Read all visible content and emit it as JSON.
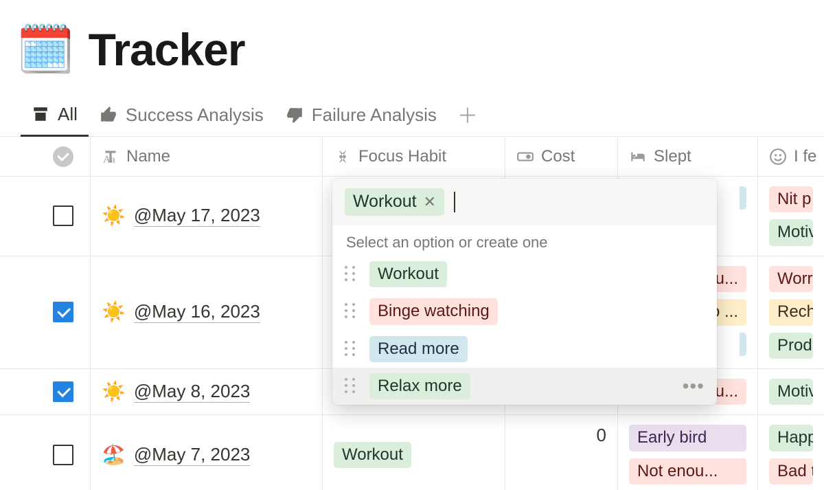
{
  "page": {
    "emoji": "🗓️",
    "title": "Tracker"
  },
  "tabs": [
    {
      "label": "All",
      "icon": "archive",
      "active": true
    },
    {
      "label": "Success Analysis",
      "icon": "thumbs-up",
      "active": false
    },
    {
      "label": "Failure Analysis",
      "icon": "thumbs-down",
      "active": false
    }
  ],
  "columns": {
    "name": "Name",
    "focus": "Focus Habit",
    "cost": "Cost",
    "slept": "Slept",
    "feel": "I fe"
  },
  "rows": [
    {
      "checked": false,
      "emoji": "☀️",
      "name": "@May 17, 2023",
      "slept_sliver": "blue",
      "feel": [
        {
          "text": "Nit p",
          "color": "red"
        },
        {
          "text": "Motiv",
          "color": "green"
        }
      ]
    },
    {
      "checked": true,
      "emoji": "☀️",
      "name": "@May 16, 2023",
      "peek": [
        {
          "text": "u...",
          "color": "red"
        },
        {
          "text": "o ...",
          "color": "yellow"
        },
        {
          "sliver": true,
          "color": "blue"
        }
      ],
      "feel": [
        {
          "text": "Worr",
          "color": "red"
        },
        {
          "text": "Rech",
          "color": "yellow"
        },
        {
          "text": "Prod",
          "color": "green"
        }
      ]
    },
    {
      "checked": true,
      "emoji": "☀️",
      "name": "@May 8, 2023",
      "peek": [
        {
          "text": "u...",
          "color": "red"
        }
      ],
      "feel": [
        {
          "text": "Motiv",
          "color": "green"
        }
      ]
    },
    {
      "checked": false,
      "emoji": "🏖️",
      "name": "@May 7, 2023",
      "focus": {
        "text": "Workout",
        "color": "green"
      },
      "cost": "0",
      "slept": [
        {
          "text": "Early bird",
          "color": "purple"
        },
        {
          "text": "Not enou...",
          "color": "red"
        }
      ],
      "feel": [
        {
          "text": "Happ",
          "color": "green"
        },
        {
          "text": "Bad t",
          "color": "red"
        }
      ]
    }
  ],
  "popover": {
    "selected": {
      "text": "Workout",
      "color": "green"
    },
    "hint": "Select an option or create one",
    "options": [
      {
        "text": "Workout",
        "color": "green"
      },
      {
        "text": "Binge watching",
        "color": "red"
      },
      {
        "text": "Read more",
        "color": "blue"
      },
      {
        "text": "Relax more",
        "color": "green",
        "hover": true
      }
    ]
  }
}
